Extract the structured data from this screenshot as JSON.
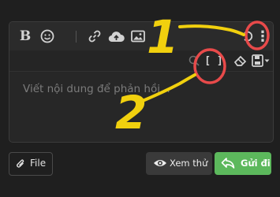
{
  "editor": {
    "placeholder": "Viết nội dung để phản hồi..."
  },
  "toolbar": {
    "icons": [
      "bold-icon",
      "smile-icon",
      "link-icon",
      "cloud-upload-icon",
      "image-icon",
      "undo-icon",
      "more-options-icon"
    ],
    "bold_glyph": "B",
    "more_glyph": "⋮",
    "row2_icons": [
      "bbcode-toggle-icon",
      "eraser-icon",
      "drafts-icon"
    ],
    "bbcode_glyph": "[ ]"
  },
  "actions": {
    "attach_label": "File",
    "preview_label": "Xem thử",
    "send_label": "Gửi đi"
  },
  "colors": {
    "background": "#1f1f1f",
    "editor": "#272727",
    "send_button": "#5cb85c",
    "annotation_circle": "#e84a4a",
    "annotation_text": "#f1d00e"
  },
  "annotations": {
    "label_1": "1",
    "label_2": "2"
  }
}
